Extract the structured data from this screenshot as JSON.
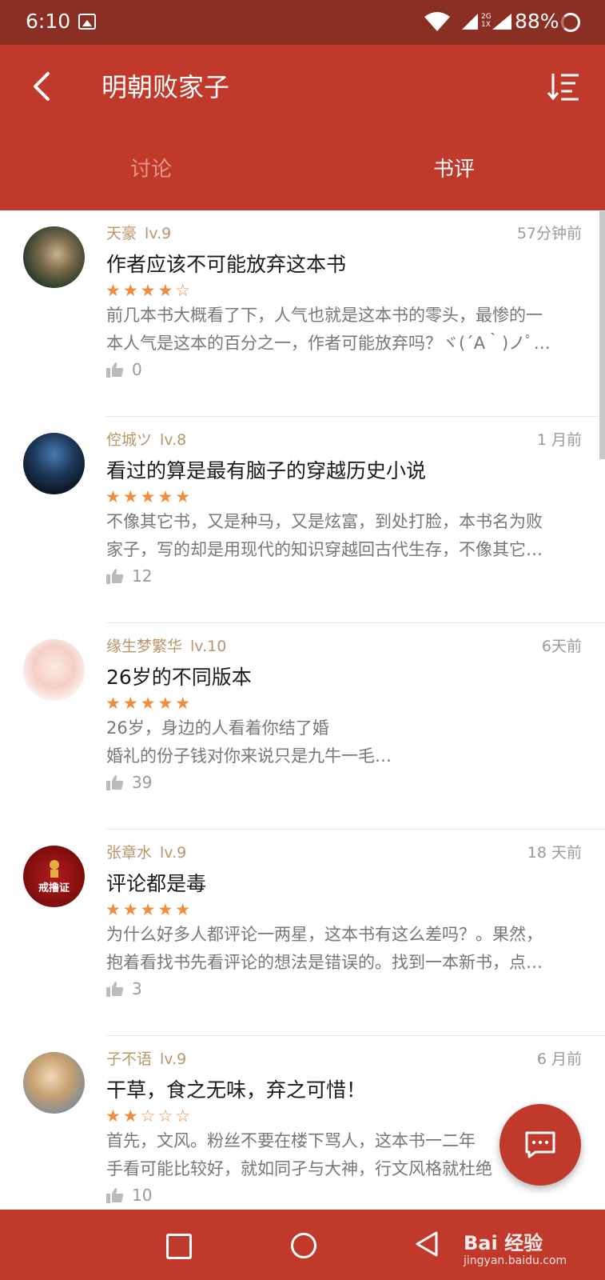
{
  "status_bar": {
    "time": "6:10",
    "network_label_top": "2G",
    "network_label_bottom": "1X",
    "battery": "88%"
  },
  "header": {
    "title": "明朝败家子",
    "tabs": [
      {
        "label": "讨论",
        "active": false
      },
      {
        "label": "书评",
        "active": true
      }
    ]
  },
  "reviews": [
    {
      "user": "天豪",
      "level": "lv.9",
      "time": "57分钟前",
      "title": "作者应该不可能放弃这本书",
      "stars": "★★★★☆",
      "rating": 4,
      "lines": [
        "前几本书大概看了下，人气也就是这本书的零头，最惨的一",
        "本人气是这本的百分之一，作者可能放弃吗？ヾ(´A｀)ノﾟ…"
      ],
      "likes": "0",
      "avatar_color": "#3a5a3a"
    },
    {
      "user": "倥城ツ",
      "level": "lv.8",
      "time": "1 月前",
      "title": "看过的算是最有脑子的穿越历史小说",
      "stars": "★★★★★",
      "rating": 5,
      "lines": [
        "不像其它书，又是种马，又是炫富，到处打脸，本书名为败",
        "家子，写的却是用现代的知识穿越回古代生存，不像其它…"
      ],
      "likes": "12",
      "avatar_color": "#0a1a2a"
    },
    {
      "user": "缘生梦繁华",
      "level": "lv.10",
      "time": "6天前",
      "title": "26岁的不同版本",
      "stars": "★★★★★",
      "rating": 5,
      "lines": [
        "26岁，身边的人看着你结了婚",
        "婚礼的份子钱对你来说只是九牛一毛…"
      ],
      "likes": "39",
      "avatar_color": "#f3d9d4"
    },
    {
      "user": "张章水",
      "level": "lv.9",
      "time": "18 天前",
      "title": "评论都是毒",
      "stars": "★★★★★",
      "rating": 5,
      "lines": [
        "为什么好多人都评论一两星，这本书有这么差吗？。果然，",
        "抱着看找书先看评论的想法是错误的。找到一本新书，点…"
      ],
      "likes": "3",
      "avatar_color": "#9b1010",
      "avatar_text": "戒撸证"
    },
    {
      "user": "子不语",
      "level": "lv.9",
      "time": "6 月前",
      "title": "干草，食之无味，弃之可惜！",
      "stars": "★★☆☆☆",
      "rating": 2,
      "lines": [
        "首先，文风。粉丝不要在楼下骂人，这本书一二年",
        "手看可能比较好，就如同孑与大神，行文风格就杜绝"
      ],
      "likes": "10",
      "avatar_color": "#c8a070"
    }
  ],
  "watermark": {
    "brand": "Bai 经验",
    "url": "jingyan.baidu.com"
  },
  "colors": {
    "primary": "#c0392b",
    "status_bar": "#8b2f24",
    "star": "#f08c3c",
    "username": "#b9966a"
  }
}
